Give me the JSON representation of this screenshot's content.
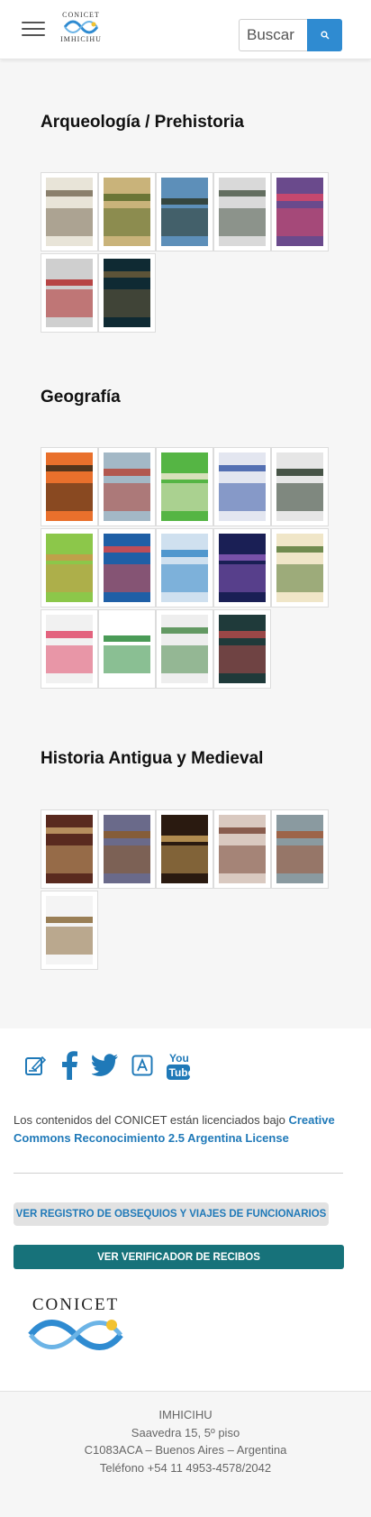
{
  "header": {
    "logo_top": "CONICET",
    "logo_bottom": "IMHICIHU",
    "search_placeholder": "Buscar"
  },
  "sections": [
    {
      "title": "Arqueología / Prehistoria",
      "covers": [
        {
          "bg": "#e8e4d8",
          "accent": "#7a6e5a"
        },
        {
          "bg": "#c9b37a",
          "accent": "#5a6b2c"
        },
        {
          "bg": "#5d8fb9",
          "accent": "#2e3a2a"
        },
        {
          "bg": "#d9d9d9",
          "accent": "#4d5a4a"
        },
        {
          "bg": "#6a4a8c",
          "accent": "#d5486a"
        },
        {
          "bg": "#cfcfcf",
          "accent": "#b32d2d"
        },
        {
          "bg": "#0f2a33",
          "accent": "#6a5a3a"
        }
      ]
    },
    {
      "title": "Geografía",
      "covers": [
        {
          "bg": "#e9702c",
          "accent": "#3a2a1a"
        },
        {
          "bg": "#a3b8c6",
          "accent": "#b5463a"
        },
        {
          "bg": "#55b544",
          "accent": "#f0e8d0"
        },
        {
          "bg": "#e3e6f0",
          "accent": "#3b5aa8"
        },
        {
          "bg": "#e6e6e6",
          "accent": "#2a3a2a"
        },
        {
          "bg": "#8cc74a",
          "accent": "#c89a4a"
        },
        {
          "bg": "#1f5fa6",
          "accent": "#d94a4a"
        },
        {
          "bg": "#cfe0ef",
          "accent": "#3a8ac8"
        },
        {
          "bg": "#1a1f55",
          "accent": "#8a5ab8"
        },
        {
          "bg": "#f0e6c8",
          "accent": "#5a7a3a"
        },
        {
          "bg": "#f1f1f1",
          "accent": "#e04a6a"
        },
        {
          "bg": "#ffffff",
          "accent": "#2a8a3a"
        },
        {
          "bg": "#eeeeee",
          "accent": "#4a8a4a"
        },
        {
          "bg": "#1f3a3a",
          "accent": "#b04a4a"
        }
      ]
    },
    {
      "title": "Historia Antigua y Medieval",
      "covers": [
        {
          "bg": "#5a2a1f",
          "accent": "#c8a06a"
        },
        {
          "bg": "#6a6a8a",
          "accent": "#8a5a2a"
        },
        {
          "bg": "#2a1a10",
          "accent": "#c8a05a"
        },
        {
          "bg": "#d9c9c0",
          "accent": "#7a4a3a"
        },
        {
          "bg": "#8a9aa0",
          "accent": "#a05a3a"
        },
        {
          "bg": "#f4f4f4",
          "accent": "#8a6a3a"
        }
      ]
    }
  ],
  "footer": {
    "social": [
      "blog-icon",
      "facebook-icon",
      "twitter-icon",
      "app-store-icon",
      "youtube-icon"
    ],
    "license_text": "Los contenidos del CONICET están licenciados bajo ",
    "license_link": "Creative Commons Reconocimiento 2.5 Argentina License",
    "registro_button": "VER REGISTRO DE OBSEQUIOS Y VIAJES DE FUNCIONARIOS",
    "verificador_button": "VER VERIFICADOR DE RECIBOS",
    "logo_text": "CONICET",
    "address": {
      "line1": "IMHICIHU",
      "line2": "Saavedra 15, 5º piso",
      "line3": "C1083ACA – Buenos Aires – Argentina",
      "line4": "Teléfono +54 11 4953-4578/2042"
    }
  },
  "colors": {
    "brand_blue": "#2f8bd1",
    "link_blue": "#1f79b8",
    "teal": "#17727a"
  }
}
